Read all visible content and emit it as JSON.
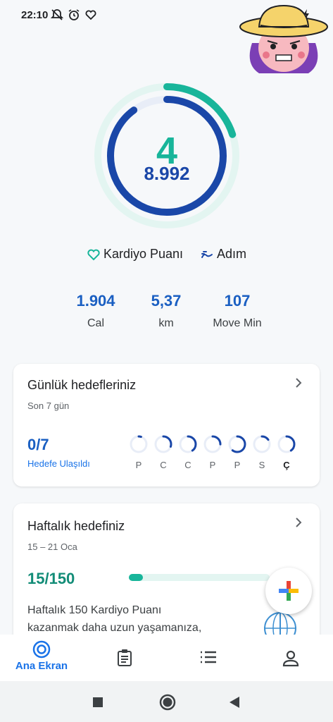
{
  "status_bar": {
    "time": "22:10",
    "left_icons": [
      "mute-notification-icon",
      "alarm-icon",
      "heart-activity-icon"
    ],
    "right_icons": [
      "signal-icon",
      "wifi-icon",
      "battery-charging-icon"
    ]
  },
  "summary": {
    "heart_points": "4",
    "steps": "8.992",
    "heart_points_goal_fraction": 0.2,
    "steps_goal_fraction": 0.9
  },
  "legend": {
    "heart_label": "Kardiyo Puanı",
    "steps_label": "Adım"
  },
  "stats": [
    {
      "value": "1.904",
      "label": "Cal"
    },
    {
      "value": "5,37",
      "label": "km"
    },
    {
      "value": "107",
      "label": "Move Min"
    }
  ],
  "daily_goals": {
    "title": "Günlük hedefleriniz",
    "subtitle": "Son 7 gün",
    "achieved": "0/7",
    "achieved_label": "Hedefe Ulaşıldı",
    "days": [
      {
        "label": "P",
        "progress": 0.05
      },
      {
        "label": "C",
        "progress": 0.3
      },
      {
        "label": "C",
        "progress": 0.4
      },
      {
        "label": "P",
        "progress": 0.25
      },
      {
        "label": "P",
        "progress": 0.6
      },
      {
        "label": "S",
        "progress": 0.15
      },
      {
        "label": "Ç",
        "progress": 0.4
      }
    ]
  },
  "weekly_goal": {
    "title": "Haftalık hedefiniz",
    "subtitle": "15 – 21 Oca",
    "value": "15/150",
    "progress": 0.1,
    "description_line1": "Haftalık 150 Kardiyo Puanı",
    "description_line2": "kazanmak daha uzun yaşamanıza,"
  },
  "bottom_nav": {
    "home_label": "Ana Ekran"
  },
  "colors": {
    "teal": "#18b59a",
    "blue": "#1a47a8",
    "link_blue": "#1a73e8"
  }
}
